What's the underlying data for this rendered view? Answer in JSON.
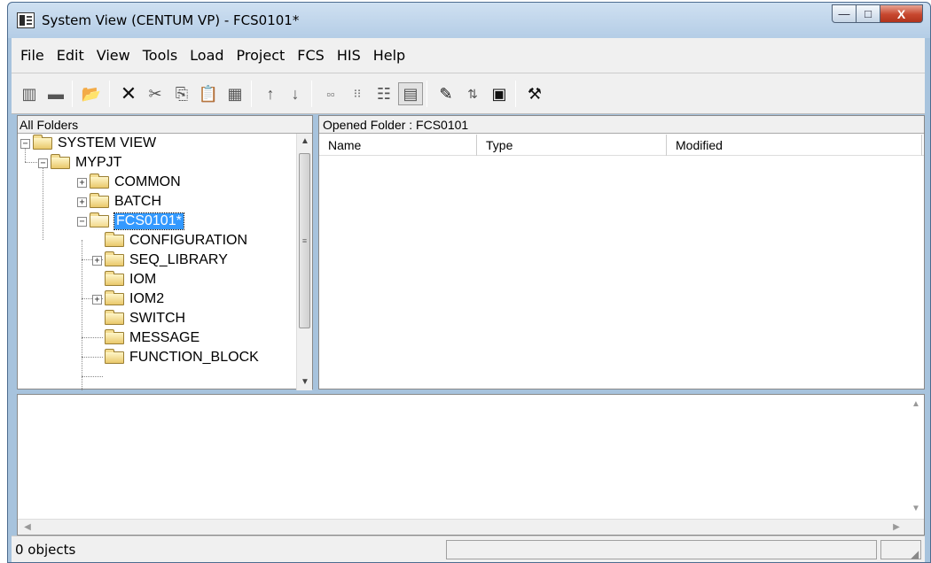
{
  "window": {
    "title": "System View (CENTUM VP) - FCS0101*",
    "controls": {
      "minimize": "—",
      "maximize": "□",
      "close": "X"
    }
  },
  "menubar": {
    "items": [
      "File",
      "Edit",
      "View",
      "Tools",
      "Load",
      "Project",
      "FCS",
      "HIS",
      "Help"
    ]
  },
  "toolbar": {
    "buttons": [
      "text-icon",
      "view-icon",
      "open-folder-icon",
      "delete-icon",
      "cut-icon",
      "copy-icon",
      "paste-icon",
      "properties-icon",
      "up-arrow-icon",
      "down-arrow-icon",
      "large-icons-icon",
      "small-icons-icon",
      "list-icon",
      "details-icon",
      "edit-icon",
      "sort-icon",
      "builder-icon",
      "tool-icon"
    ]
  },
  "left_pane": {
    "header": "All Folders",
    "tree": [
      {
        "label": "SYSTEM VIEW",
        "expander": "−"
      },
      {
        "label": "MYPJT",
        "expander": "−"
      },
      {
        "label": "COMMON",
        "expander": "+"
      },
      {
        "label": "BATCH",
        "expander": "+"
      },
      {
        "label": "FCS0101*",
        "expander": "−",
        "selected": true
      },
      {
        "label": "CONFIGURATION"
      },
      {
        "label": "SEQ_LIBRARY",
        "expander": "+"
      },
      {
        "label": "IOM"
      },
      {
        "label": "IOM2",
        "expander": "+"
      },
      {
        "label": "SWITCH"
      },
      {
        "label": "MESSAGE"
      },
      {
        "label": "FUNCTION_BLOCK"
      }
    ],
    "scroll_up": "▲",
    "scroll_down": "▼",
    "thumb_grip": "≡"
  },
  "right_pane": {
    "header": "Opened Folder : FCS0101",
    "columns": [
      "Name",
      "Type",
      "Modified"
    ]
  },
  "bottom_pane": {
    "scroll_up": "▲",
    "scroll_down": "▼",
    "scroll_left": "◀",
    "scroll_right": "▶"
  },
  "statusbar": {
    "text": "0 objects"
  }
}
